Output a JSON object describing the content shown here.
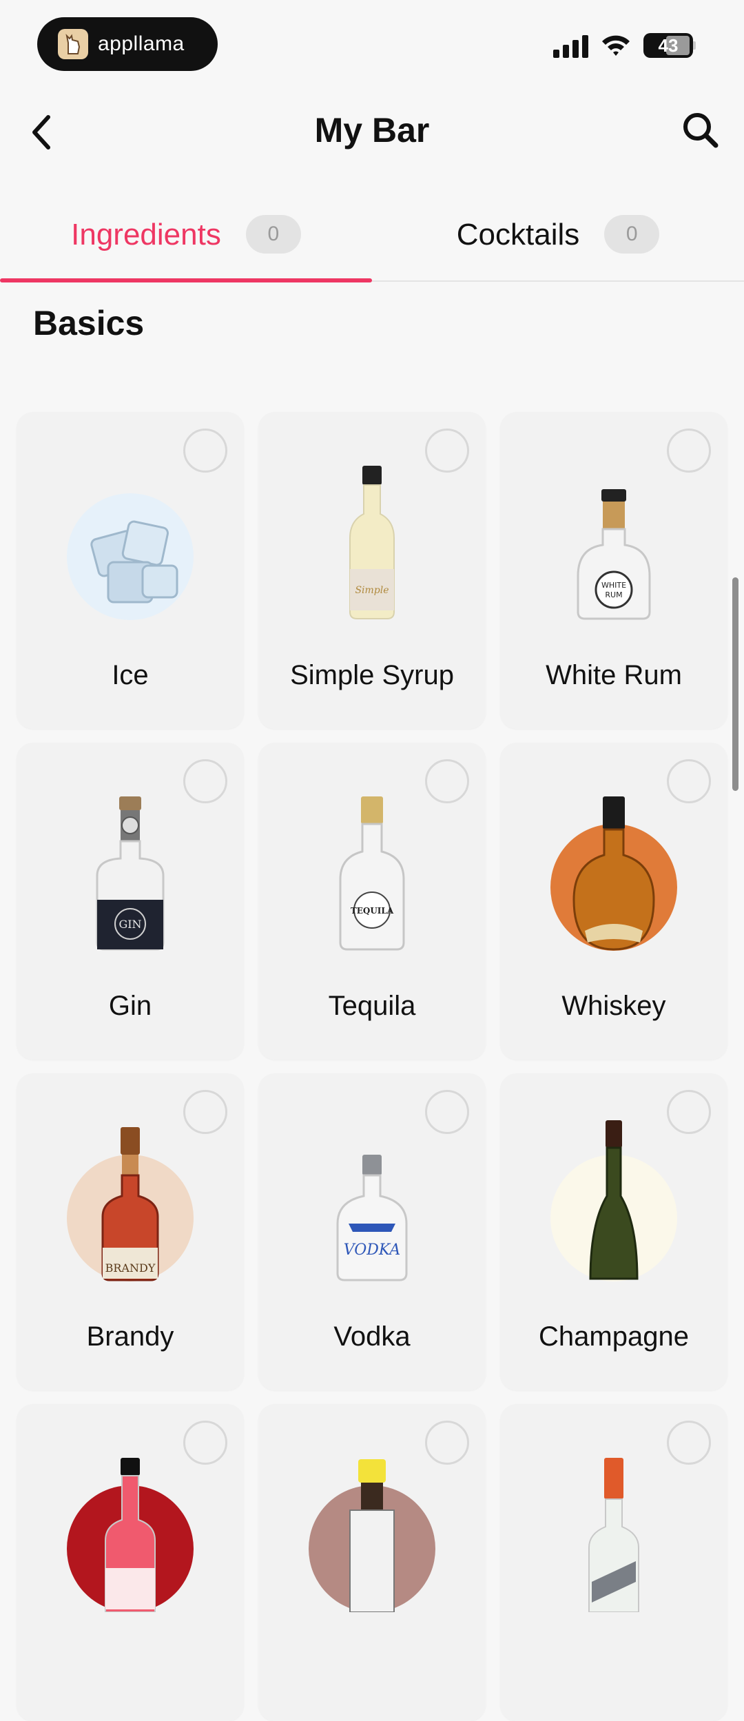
{
  "status_bar": {
    "brand": "appllama",
    "battery": "43"
  },
  "navbar": {
    "title": "My Bar"
  },
  "tabs": [
    {
      "label": "Ingredients",
      "count": "0"
    },
    {
      "label": "Cocktails",
      "count": "0"
    }
  ],
  "section": {
    "title": "Basics"
  },
  "ingredients": [
    {
      "name": "Ice"
    },
    {
      "name": "Simple Syrup"
    },
    {
      "name": "White Rum"
    },
    {
      "name": "Gin"
    },
    {
      "name": "Tequila"
    },
    {
      "name": "Whiskey"
    },
    {
      "name": "Brandy"
    },
    {
      "name": "Vodka"
    },
    {
      "name": "Champagne"
    },
    {
      "name": ""
    },
    {
      "name": ""
    },
    {
      "name": ""
    }
  ],
  "colors": {
    "accent": "#ee3763",
    "whiskey_bg": "#e07b39",
    "brandy_bg": "#f0d9c6",
    "champagne_bg": "#fbf8ea",
    "grenadine_bg": "#b3161e",
    "bitters_bg": "#b58a83",
    "ice_bg": "#e6f1fa"
  }
}
